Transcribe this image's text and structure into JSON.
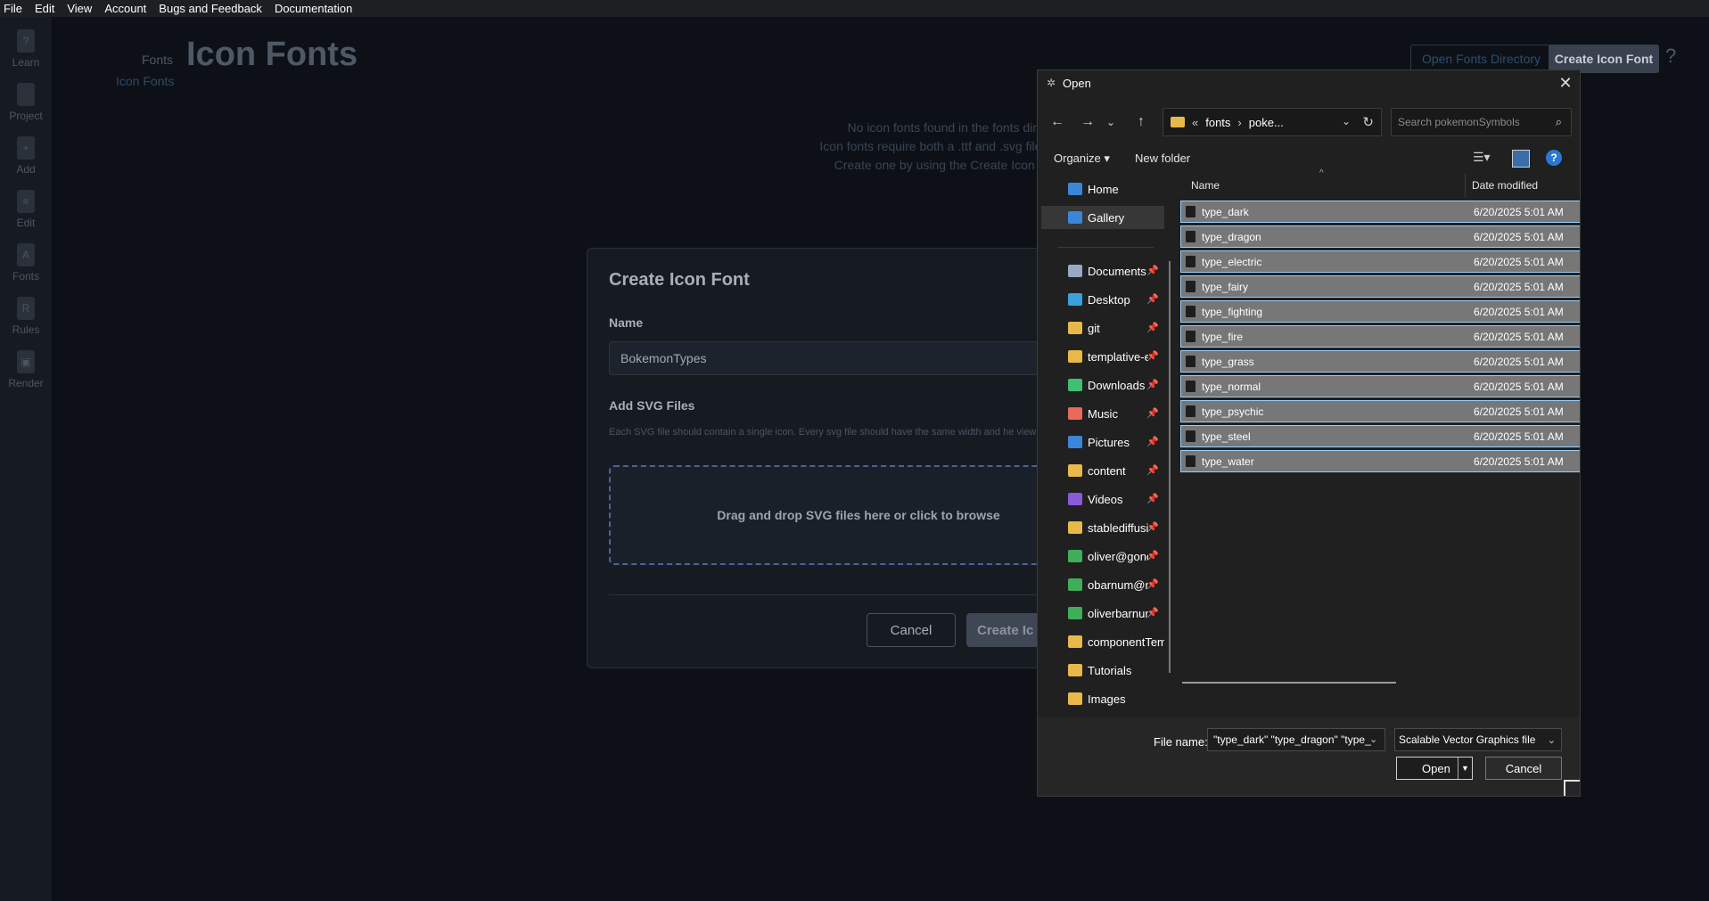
{
  "menubar": {
    "items": [
      "File",
      "Edit",
      "View",
      "Account",
      "Bugs and Feedback",
      "Documentation"
    ]
  },
  "sidebar": {
    "items": [
      {
        "label": "Learn",
        "icon": "question-icon"
      },
      {
        "label": "Project",
        "icon": "project-icon"
      },
      {
        "label": "Add",
        "icon": "add-icon"
      },
      {
        "label": "Edit",
        "icon": "edit-icon"
      },
      {
        "label": "Fonts",
        "icon": "fonts-icon"
      },
      {
        "label": "Rules",
        "icon": "rules-icon"
      },
      {
        "label": "Render",
        "icon": "render-icon"
      }
    ]
  },
  "page": {
    "breadcrumb_fonts": "Fonts",
    "breadcrumb_icon_fonts": "Icon Fonts",
    "title": "Icon Fonts",
    "open_fonts_dir_label": "Open Fonts Directory",
    "create_icon_font_label": "Create Icon Font",
    "empty_lines": [
      "No icon fonts found in the fonts directo",
      "Icon fonts require both a .ttf and .svg file with the",
      "Create one by using the Create Icon Font b"
    ]
  },
  "modal": {
    "title": "Create Icon Font",
    "name_label": "Name",
    "name_value": "BokemonTypes",
    "svg_label": "Add SVG Files",
    "svg_description": "Each SVG file should contain a single icon. Every svg file should have the same width and he viewBox.",
    "dropzone_text": "Drag and drop SVG files here or click to browse",
    "cancel_label": "Cancel",
    "create_label": "Create Ic"
  },
  "dialog": {
    "title": "Open",
    "address": {
      "chevrons": "«",
      "segment1": "fonts",
      "separator": "›",
      "segment2": "poke..."
    },
    "search_placeholder": "Search pokemonSymbols",
    "organize_label": "Organize ▾",
    "new_folder_label": "New folder",
    "nav_items": [
      {
        "label": "Home",
        "color": "#3a86d8",
        "pinned": false
      },
      {
        "label": "Gallery",
        "color": "#3a86d8",
        "pinned": false
      },
      {
        "label": "Documents",
        "color": "#9aa8c2",
        "pinned": true
      },
      {
        "label": "Desktop",
        "color": "#3aa0e0",
        "pinned": true
      },
      {
        "label": "git",
        "color": "#e8b94a",
        "pinned": true
      },
      {
        "label": "templative-e",
        "color": "#e8b94a",
        "pinned": true
      },
      {
        "label": "Downloads",
        "color": "#3fbf6f",
        "pinned": true
      },
      {
        "label": "Music",
        "color": "#e86a5a",
        "pinned": true
      },
      {
        "label": "Pictures",
        "color": "#3a86d8",
        "pinned": true
      },
      {
        "label": "content",
        "color": "#e8b94a",
        "pinned": true
      },
      {
        "label": "Videos",
        "color": "#8a5ad8",
        "pinned": true
      },
      {
        "label": "stablediffusic",
        "color": "#e8b94a",
        "pinned": true
      },
      {
        "label": "oliver@gone",
        "color": "#3fae5a",
        "pinned": true
      },
      {
        "label": "obarnum@n",
        "color": "#3fae5a",
        "pinned": true
      },
      {
        "label": "oliverbarnum",
        "color": "#3fae5a",
        "pinned": true
      },
      {
        "label": "componentTem",
        "color": "#e8b94a",
        "pinned": false
      },
      {
        "label": "Tutorials",
        "color": "#e8b94a",
        "pinned": false
      },
      {
        "label": "Images",
        "color": "#e8b94a",
        "pinned": false
      }
    ],
    "columns": {
      "name": "Name",
      "date": "Date modified"
    },
    "files": [
      {
        "name": "type_dark",
        "date": "6/20/2025 5:01 AM"
      },
      {
        "name": "type_dragon",
        "date": "6/20/2025 5:01 AM"
      },
      {
        "name": "type_electric",
        "date": "6/20/2025 5:01 AM"
      },
      {
        "name": "type_fairy",
        "date": "6/20/2025 5:01 AM"
      },
      {
        "name": "type_fighting",
        "date": "6/20/2025 5:01 AM"
      },
      {
        "name": "type_fire",
        "date": "6/20/2025 5:01 AM"
      },
      {
        "name": "type_grass",
        "date": "6/20/2025 5:01 AM"
      },
      {
        "name": "type_normal",
        "date": "6/20/2025 5:01 AM"
      },
      {
        "name": "type_psychic",
        "date": "6/20/2025 5:01 AM"
      },
      {
        "name": "type_steel",
        "date": "6/20/2025 5:01 AM"
      },
      {
        "name": "type_water",
        "date": "6/20/2025 5:01 AM"
      }
    ],
    "file_name_label": "File name:",
    "file_name_value": "\"type_dark\" \"type_dragon\" \"type_",
    "file_type_value": "Scalable Vector Graphics file",
    "open_label": "Open",
    "cancel_label": "Cancel"
  }
}
